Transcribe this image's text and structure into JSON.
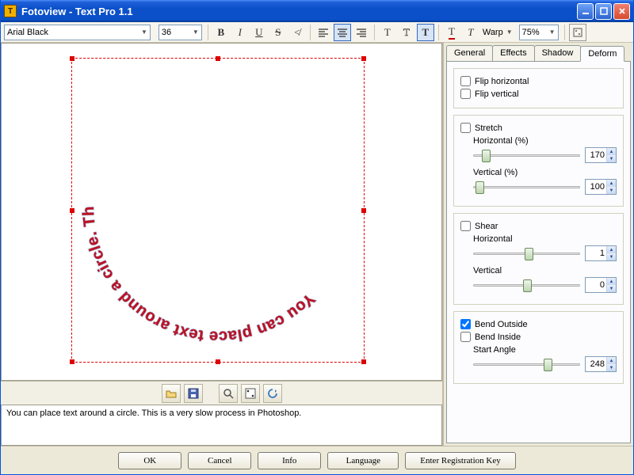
{
  "window": {
    "title": "Fotoview - Text Pro 1.1"
  },
  "toolbar": {
    "font": "Arial Black",
    "size": "36",
    "warp_label": "Warp",
    "zoom": "75%"
  },
  "canvas": {
    "circle_text": "You can place text around a circle.  This is a very slow process in Photoshop.  "
  },
  "text_input": "You can place text around a circle. This is a very slow process in Photoshop.",
  "tabs": {
    "general": "General",
    "effects": "Effects",
    "shadow": "Shadow",
    "deform": "Deform"
  },
  "deform": {
    "flip_h": "Flip horizontal",
    "flip_v": "Flip vertical",
    "stretch": "Stretch",
    "stretch_h_label": "Horizontal (%)",
    "stretch_h_value": "170",
    "stretch_v_label": "Vertical (%)",
    "stretch_v_value": "100",
    "shear": "Shear",
    "shear_h_label": "Horizontal",
    "shear_h_value": "1",
    "shear_v_label": "Vertical",
    "shear_v_value": "0",
    "bend_outside": "Bend Outside",
    "bend_inside": "Bend Inside",
    "start_angle_label": "Start Angle",
    "start_angle_value": "248"
  },
  "footer": {
    "ok": "OK",
    "cancel": "Cancel",
    "info": "Info",
    "language": "Language",
    "register": "Enter Registration Key"
  }
}
